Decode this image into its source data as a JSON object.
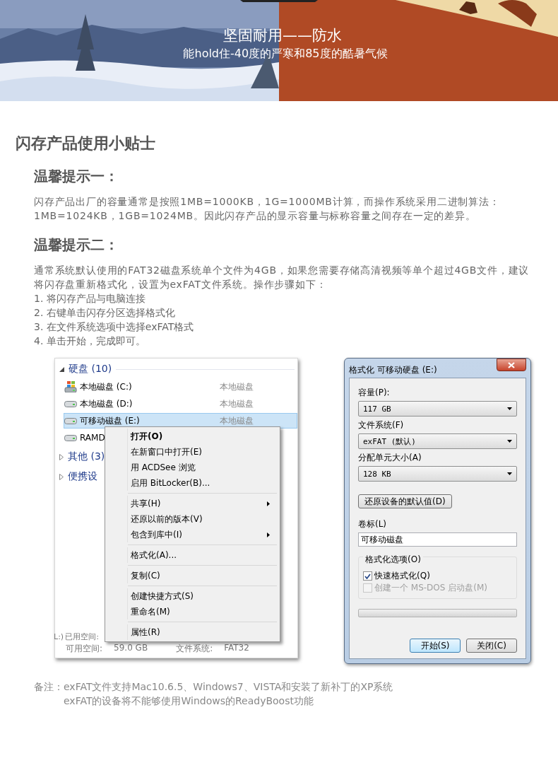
{
  "banner": {
    "kind": "picture",
    "title": "坚固耐用——防水",
    "subtitle": "能hold住-40度的严寒和85度的酷暑气候"
  },
  "page_title": "闪存产品使用小贴士",
  "tips": [
    {
      "heading": "温馨提示一：",
      "paragraph": "闪存产品出厂的容量通常是按照1MB=1000KB，1G=1000MB计算，而操作系统采用二进制算法：1MB=1024KB，1GB=1024MB。因此闪存产品的显示容量与标称容量之间存在一定的差异。"
    },
    {
      "heading": "温馨提示二：",
      "paragraph": "通常系统默认使用的FAT32磁盘系统单个文件为4GB，如果您需要存储高清视频等单个超过4GB文件，建议将闪存盘重新格式化，设置为exFAT文件系统。操作步骤如下：",
      "steps": [
        "1. 将闪存产品与电脑连接",
        "2. 右键单击闪存分区选择格式化",
        "3. 在文件系统选项中选择exFAT格式",
        "4. 单击开始，完成即可。"
      ]
    }
  ],
  "explorer": {
    "groups": [
      {
        "label": "硬盘 (10)",
        "expanded": true,
        "items": [
          {
            "name": "本地磁盘 (C:)",
            "type": "本地磁盘",
            "kind": "system",
            "selected": false
          },
          {
            "name": "本地磁盘 (D:)",
            "type": "本地磁盘",
            "kind": "drive",
            "selected": false
          },
          {
            "name": "可移动磁盘 (E:)",
            "type": "本地磁盘",
            "kind": "drive",
            "selected": true
          },
          {
            "name": "RAMD",
            "kind": "drive",
            "selected": false
          }
        ]
      },
      {
        "label": "其他 (3)",
        "expanded": false
      },
      {
        "label": "便携设",
        "expanded": false
      }
    ],
    "details": [
      [
        {
          "label": "L:)"
        },
        {
          "label": "已用空间:"
        }
      ],
      [
        {
          "label": "可用空间:",
          "value": "59.0 GB"
        },
        {
          "label": "文件系统:",
          "value": "FAT32"
        }
      ]
    ]
  },
  "context_menu": {
    "sections": [
      [
        {
          "label": "打开(O)",
          "bold": true,
          "submenu": false
        },
        {
          "label": "在新窗口中打开(E)",
          "bold": false,
          "submenu": false
        },
        {
          "label": "用 ACDSee 浏览",
          "bold": false,
          "submenu": false
        },
        {
          "label": "启用 BitLocker(B)...",
          "bold": false,
          "submenu": false
        }
      ],
      [
        {
          "label": "共享(H)",
          "bold": false,
          "submenu": true
        },
        {
          "label": "还原以前的版本(V)",
          "bold": false,
          "submenu": false
        },
        {
          "label": "包含到库中(I)",
          "bold": false,
          "submenu": true
        }
      ],
      [
        {
          "label": "格式化(A)...",
          "bold": false,
          "submenu": false
        }
      ],
      [
        {
          "label": "复制(C)",
          "bold": false,
          "submenu": false
        }
      ],
      [
        {
          "label": "创建快捷方式(S)",
          "bold": false,
          "submenu": false
        },
        {
          "label": "重命名(M)",
          "bold": false,
          "submenu": false
        }
      ],
      [
        {
          "label": "属性(R)",
          "bold": false,
          "submenu": false
        }
      ]
    ]
  },
  "format_dialog": {
    "title": "格式化 可移动硬盘 (E:)",
    "selects": [
      {
        "label": "容量(P):",
        "value": "117 GB"
      },
      {
        "label": "文件系统(F)",
        "value": "exFAT (默认)"
      },
      {
        "label": "分配单元大小(A)",
        "value": "128 KB"
      }
    ],
    "restore_button": "还原设备的默认值(D)",
    "volume": {
      "label": "卷标(L)",
      "value": "可移动磁盘"
    },
    "options": {
      "label": "格式化选项(O)",
      "checkboxes": [
        {
          "label": "快速格式化(Q)",
          "checked": true,
          "disabled": false
        },
        {
          "label": "创建一个 MS-DOS 启动盘(M)",
          "checked": false,
          "disabled": true
        }
      ]
    },
    "progress": {
      "level": 0
    },
    "buttons": [
      {
        "label": "开始(S)",
        "default": true
      },
      {
        "label": "关闭(C)",
        "default": false
      }
    ]
  },
  "note": {
    "label": "备注：",
    "lines": [
      "exFAT文件支持Mac10.6.5、Windows7、VISTA和安装了新补丁的XP系统",
      "exFAT的设备将不能够使用Windows的ReadyBoost功能"
    ]
  }
}
